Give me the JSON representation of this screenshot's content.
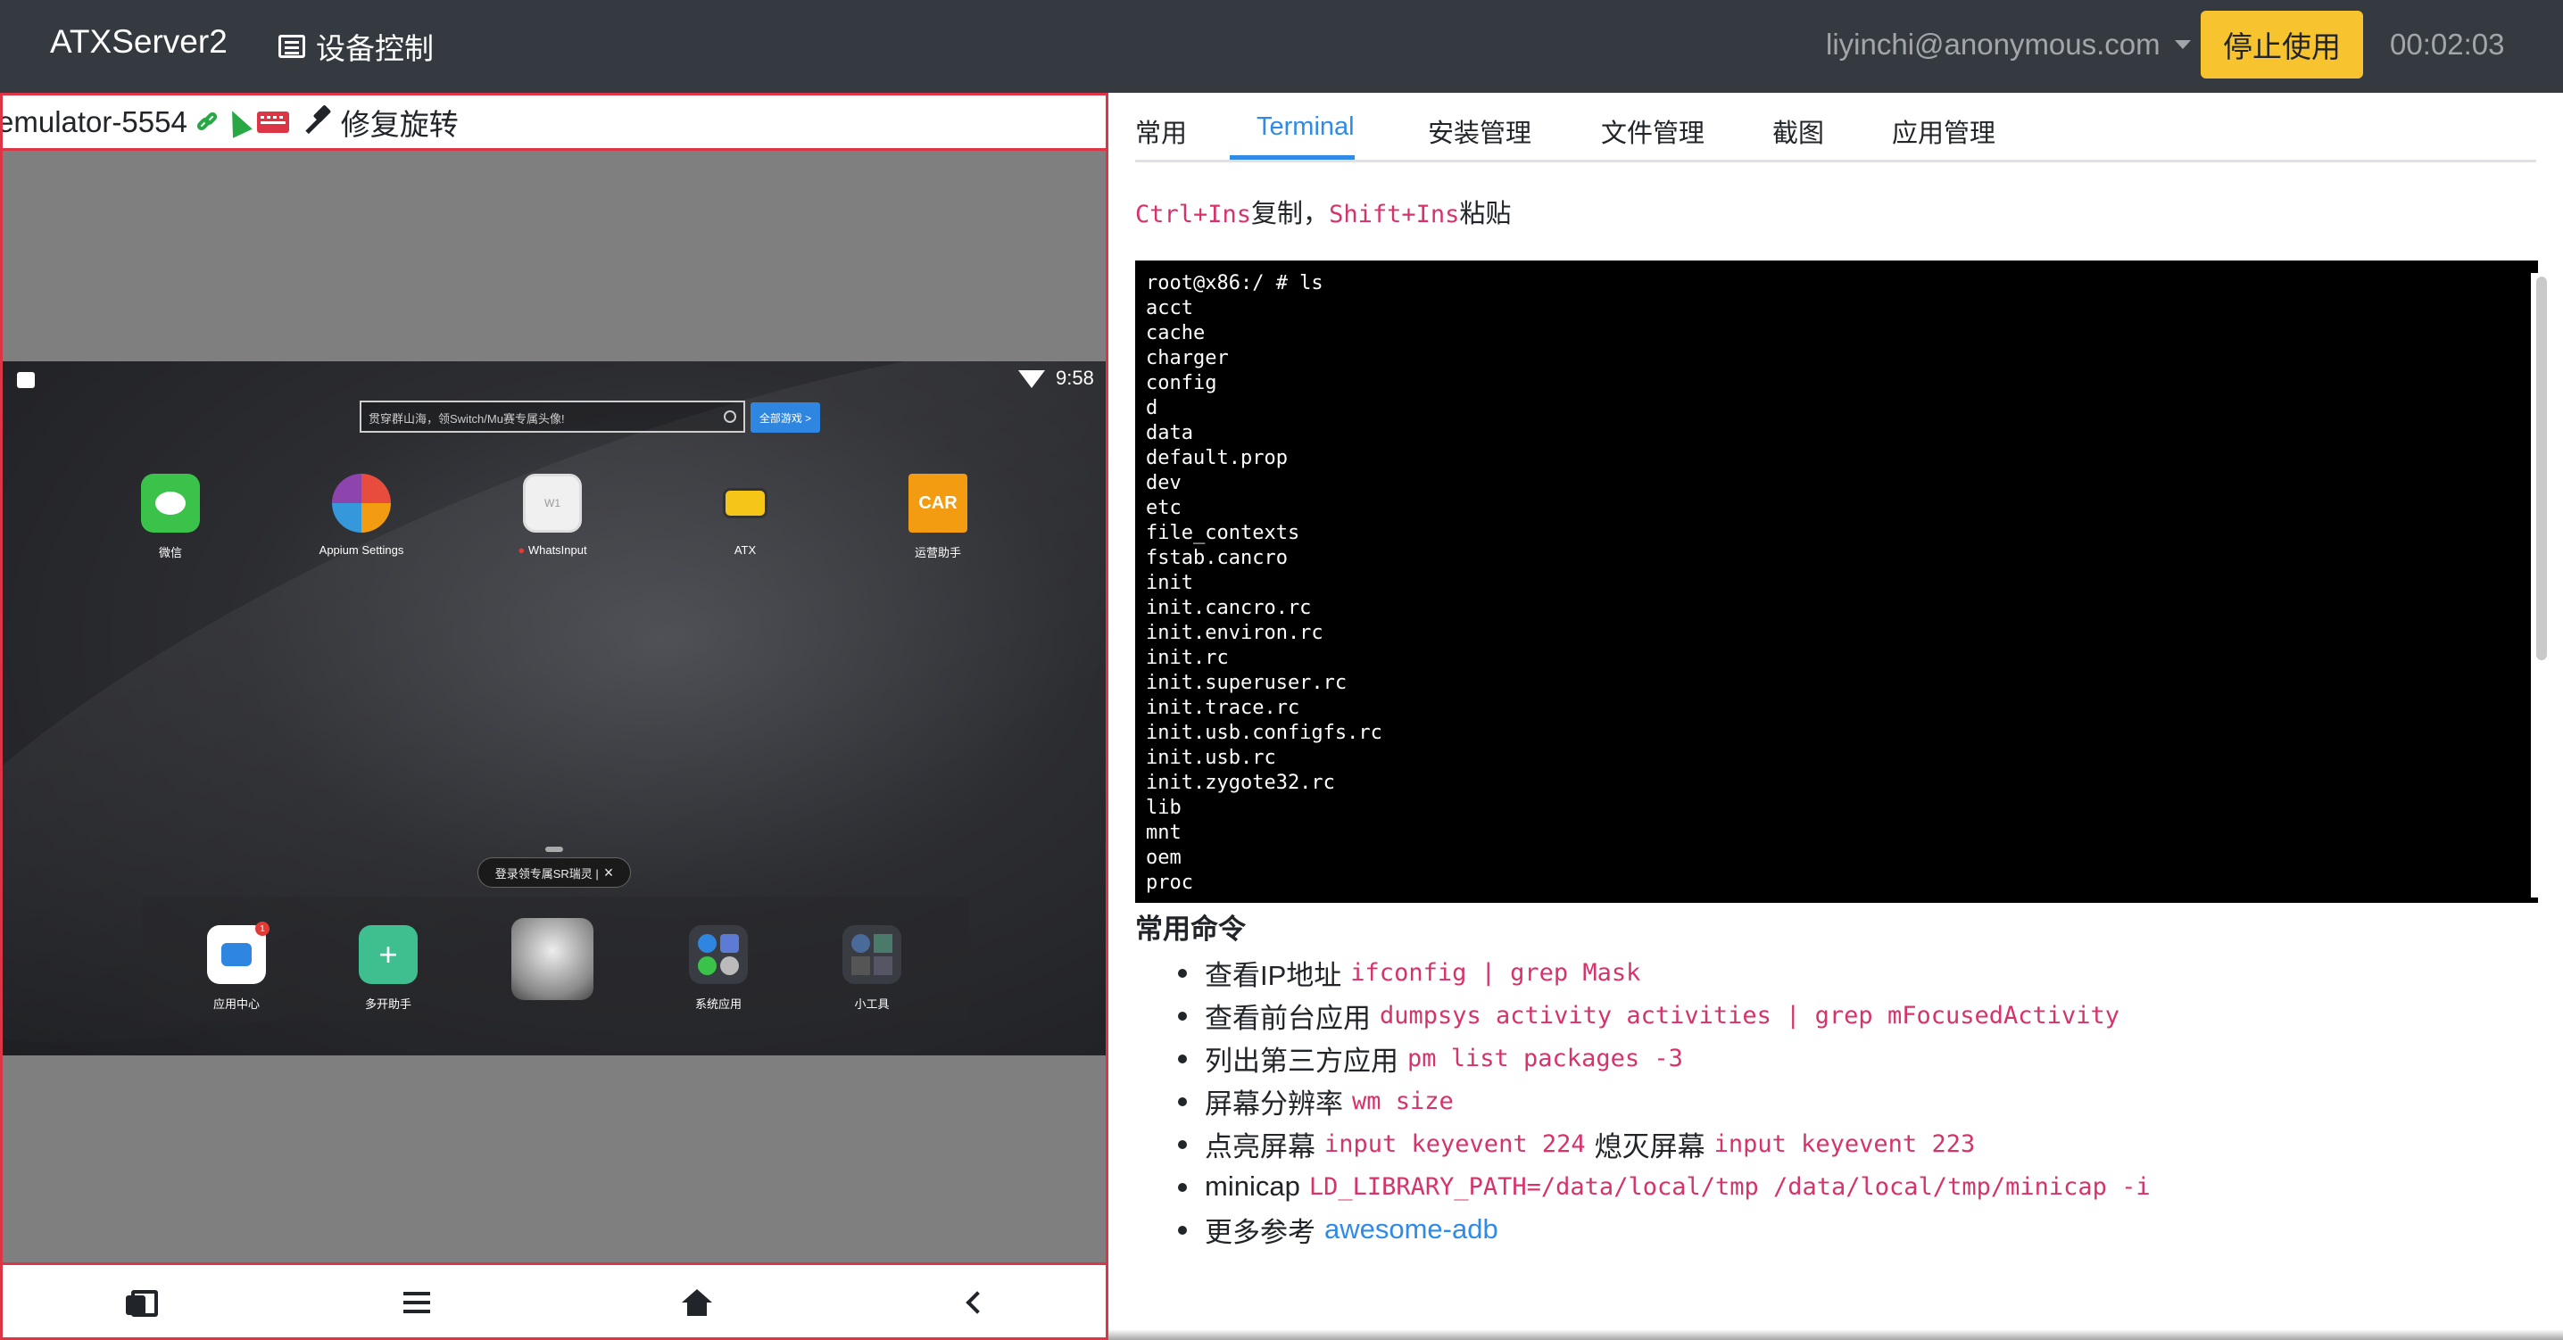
{
  "navbar": {
    "brand": "ATXServer2",
    "nav_label": "设备控制",
    "user": "liyinchi@anonymous.com",
    "stop_button": "停止使用",
    "timer": "00:02:03"
  },
  "device": {
    "serial": "emulator-5554",
    "fix_rotation_label": "修复旋转",
    "status_time": "9:58",
    "search_placeholder": "贯穿群山海，领Switch/Mu赛专属头像!",
    "search_button": "全部游戏 >",
    "tooltip": "登录领专属SR瑞灵 |",
    "apps": [
      {
        "label": "微信",
        "icon": "wechat-icon"
      },
      {
        "label": "Appium Settings",
        "icon": "appium-icon"
      },
      {
        "label": "WhatsInput",
        "icon": "whatsinput-icon"
      },
      {
        "label": "ATX",
        "icon": "atx-icon"
      },
      {
        "label": "运营助手",
        "icon": "car-icon"
      }
    ],
    "dock_apps": [
      {
        "label": "应用中心",
        "icon": "app-center-icon"
      },
      {
        "label": "多开助手",
        "icon": "multi-open-icon"
      },
      {
        "label": "",
        "icon": "game-portrait-icon"
      },
      {
        "label": "系统应用",
        "icon": "system-apps-icon"
      },
      {
        "label": "小工具",
        "icon": "tools-icon"
      }
    ],
    "badge_count": "1"
  },
  "tabs": [
    "常用",
    "Terminal",
    "安装管理",
    "文件管理",
    "截图",
    "应用管理"
  ],
  "active_tab": "Terminal",
  "hint": {
    "copy_keys": "Ctrl+Ins",
    "copy_label": "复制，",
    "paste_keys": "Shift+Ins",
    "paste_label": "粘贴"
  },
  "terminal": {
    "prompt": "root@x86:/ # ls",
    "lines": [
      "acct",
      "cache",
      "charger",
      "config",
      "d",
      "data",
      "default.prop",
      "dev",
      "etc",
      "file_contexts",
      "fstab.cancro",
      "init",
      "init.cancro.rc",
      "init.environ.rc",
      "init.rc",
      "init.superuser.rc",
      "init.trace.rc",
      "init.usb.configfs.rc",
      "init.usb.rc",
      "init.zygote32.rc",
      "lib",
      "mnt",
      "oem",
      "proc"
    ]
  },
  "commands": {
    "title": "常用命令",
    "items": [
      {
        "label": "查看IP地址",
        "cmd": "ifconfig | grep Mask"
      },
      {
        "label": "查看前台应用",
        "cmd": "dumpsys activity activities | grep mFocusedActivity"
      },
      {
        "label": "列出第三方应用",
        "cmd": "pm list packages -3"
      },
      {
        "label": "屏幕分辨率",
        "cmd": "wm size"
      },
      {
        "label": "点亮屏幕",
        "cmd": "input keyevent 224",
        "label2": "熄灭屏幕",
        "cmd2": "input keyevent 223"
      },
      {
        "label": "minicap",
        "cmd": "LD_LIBRARY_PATH=/data/local/tmp /data/local/tmp/minicap -i"
      },
      {
        "label": "更多参考",
        "link": "awesome-adb"
      }
    ]
  },
  "colors": {
    "navbar": "#343a40",
    "stop_button": "#f7c32f",
    "accent_red": "#dc3545",
    "link_blue": "#2f8be6",
    "code_pink": "#d6336c"
  }
}
